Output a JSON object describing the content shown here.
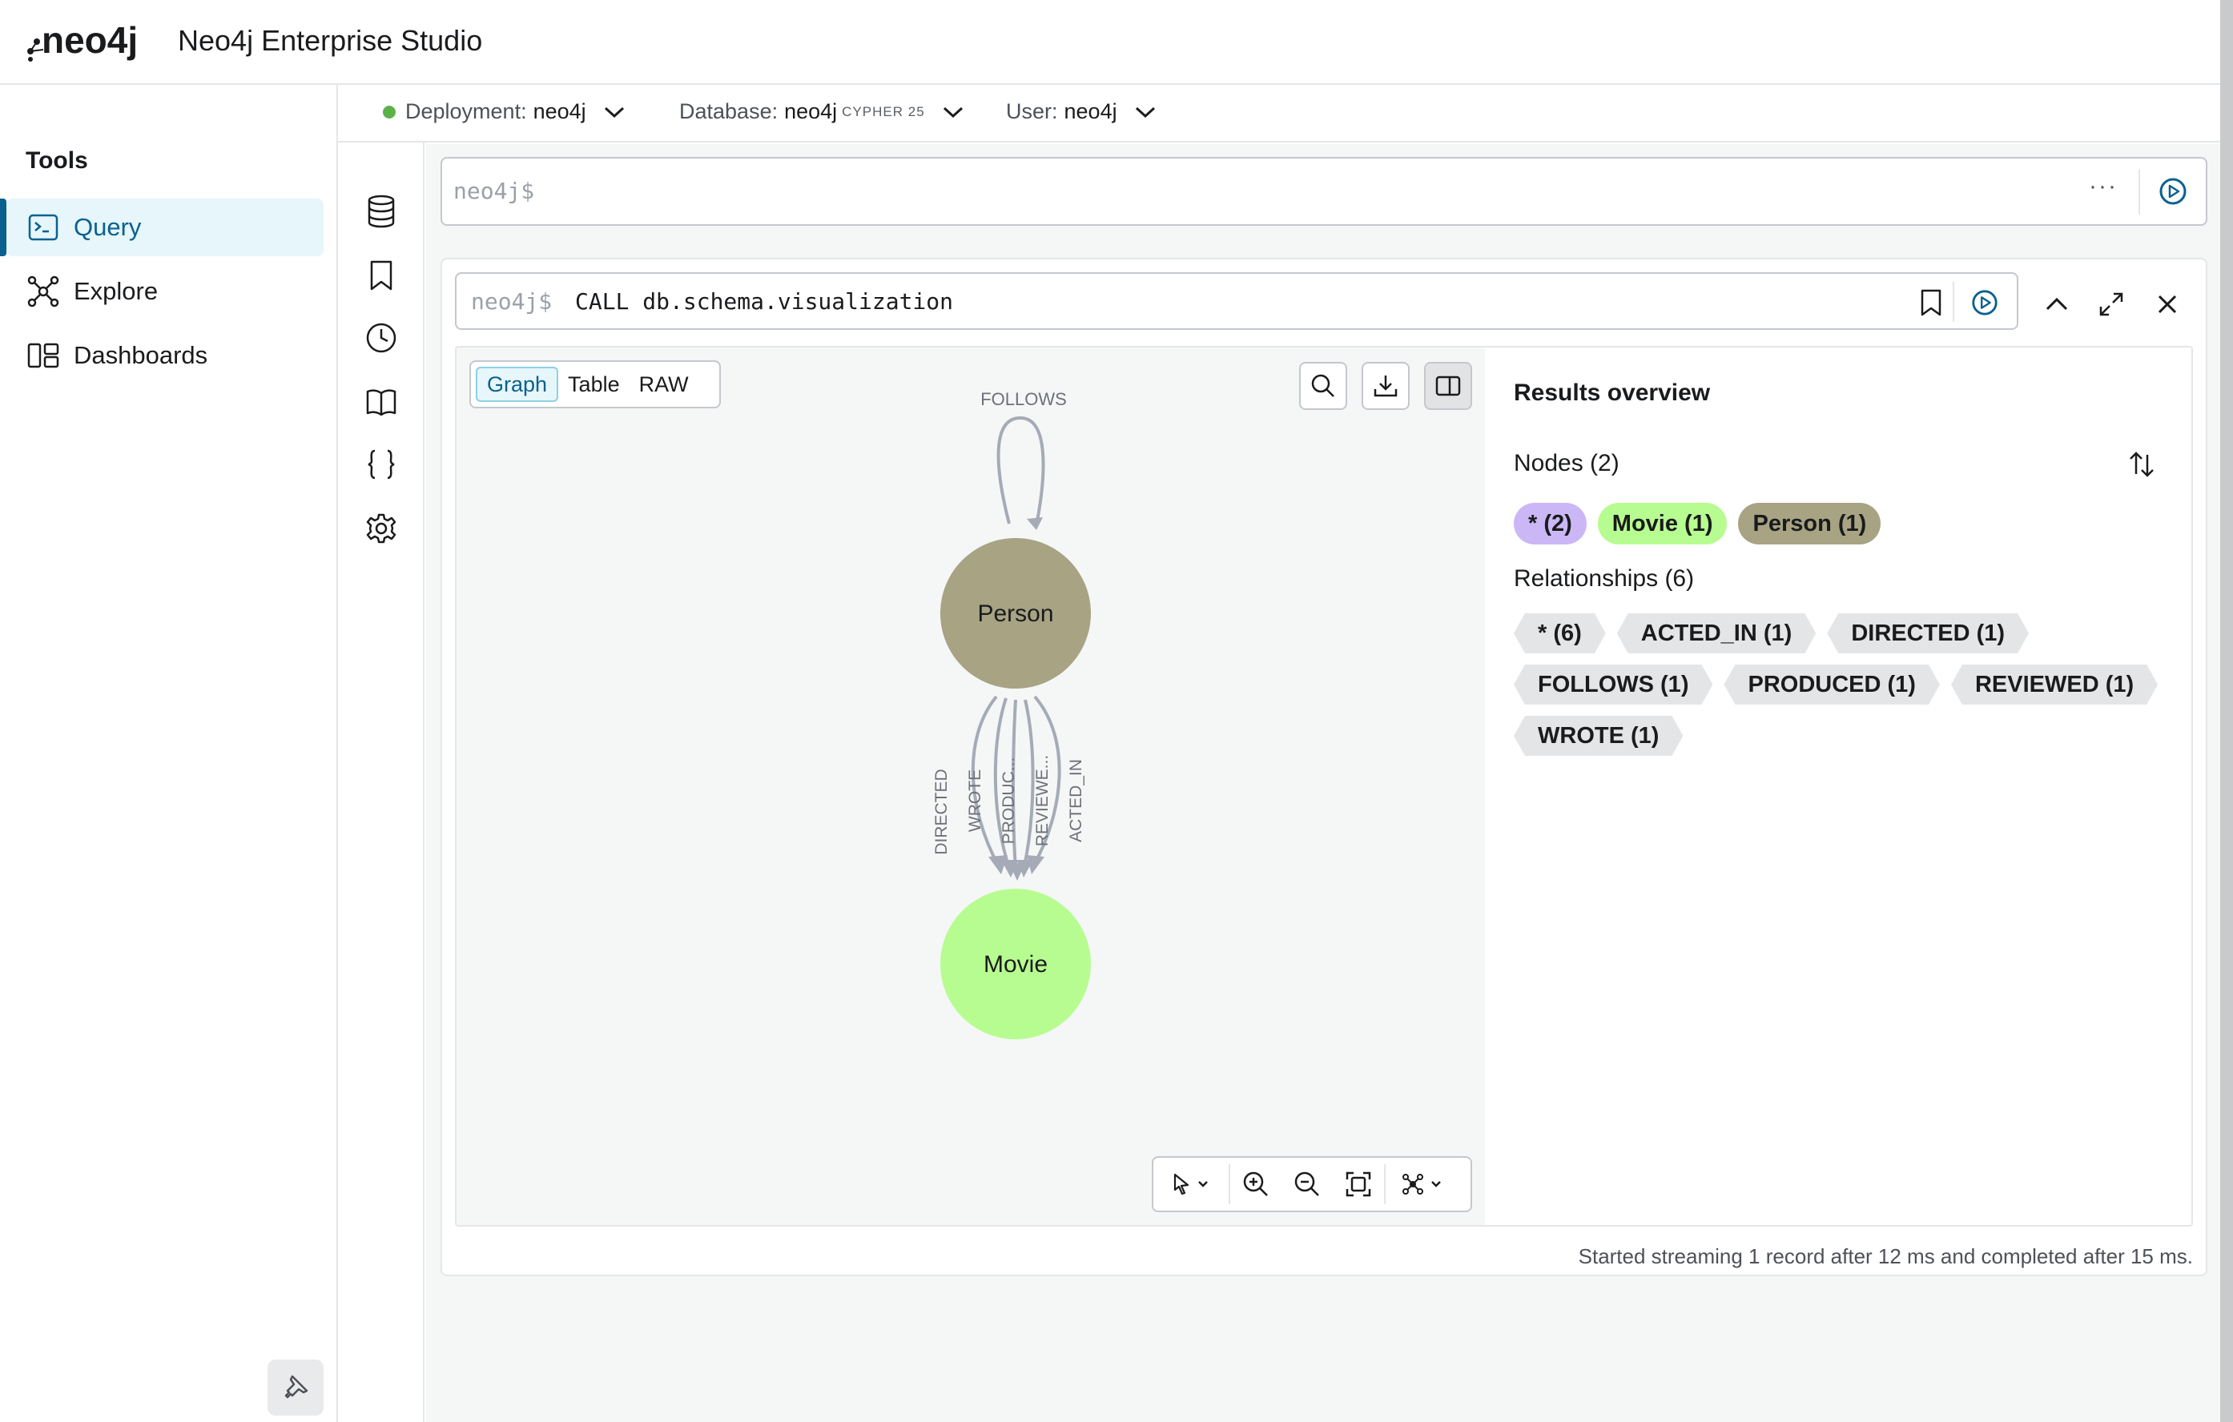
{
  "app": {
    "logo_text": "neo4j",
    "title": "Neo4j Enterprise Studio"
  },
  "sidebar": {
    "title": "Tools",
    "items": [
      {
        "label": "Query",
        "icon": "query-icon",
        "active": true
      },
      {
        "label": "Explore",
        "icon": "explore-icon",
        "active": false
      },
      {
        "label": "Dashboards",
        "icon": "dashboards-icon",
        "active": false
      }
    ],
    "pin_icon": "pin-icon"
  },
  "connection": {
    "deployment_label": "Deployment:",
    "deployment_value": "neo4j",
    "deployment_status_color": "#5db14a",
    "database_label": "Database:",
    "database_value": "neo4j",
    "database_badge": "CYPHER 25",
    "user_label": "User:",
    "user_value": "neo4j"
  },
  "rail": [
    "database-icon",
    "bookmark-icon",
    "history-icon",
    "book-icon",
    "braces-icon",
    "gear-icon"
  ],
  "editor": {
    "prompt": "neo4j$",
    "more": "···"
  },
  "result_card": {
    "prompt": "neo4j$",
    "query": "CALL db.schema.visualization",
    "view_tabs": [
      "Graph",
      "Table",
      "RAW"
    ],
    "active_tab": "Graph",
    "status": "Started streaming 1 record after 12 ms and completed after 15 ms."
  },
  "graph": {
    "nodes": [
      {
        "label": "Person",
        "color": "#a7a383"
      },
      {
        "label": "Movie",
        "color": "#b7fc90"
      }
    ],
    "self_loop_label": "FOLLOWS",
    "edge_labels": [
      "DIRECTED",
      "WROTE",
      "PRODUC...",
      "REVIEWE...",
      "ACTED_IN"
    ]
  },
  "overview": {
    "title": "Results overview",
    "nodes_heading": "Nodes (2)",
    "node_chips": [
      {
        "label": "* (2)",
        "color": "#cbb7f5"
      },
      {
        "label": "Movie (1)",
        "color": "#b7fc90"
      },
      {
        "label": "Person (1)",
        "color": "#a7a383"
      }
    ],
    "relationships_heading": "Relationships (6)",
    "rel_chips": [
      "* (6)",
      "ACTED_IN (1)",
      "DIRECTED (1)",
      "FOLLOWS (1)",
      "PRODUCED (1)",
      "REVIEWED (1)",
      "WROTE (1)"
    ]
  }
}
